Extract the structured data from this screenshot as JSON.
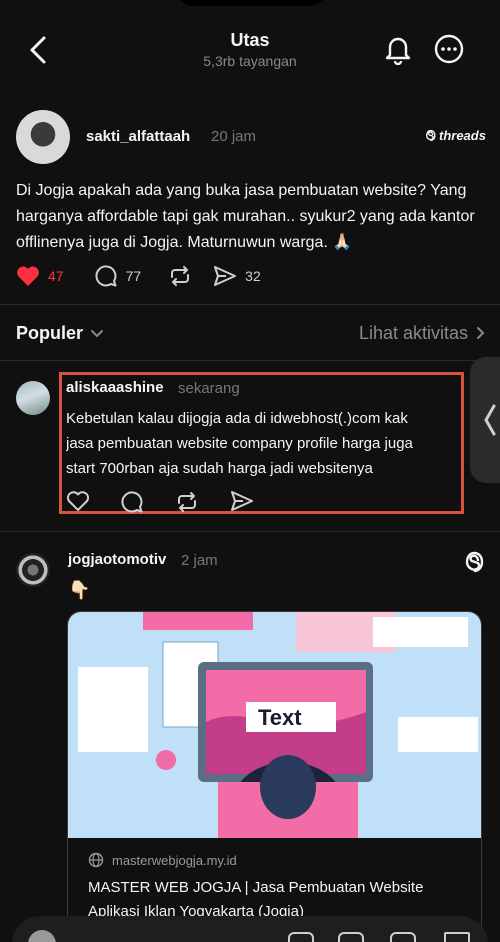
{
  "header": {
    "title": "Utas",
    "views": "5,3rb tayangan"
  },
  "post": {
    "username": "sakti_alfattaah",
    "time": "20 jam",
    "brand": "threads",
    "text": "Di Jogja apakah ada yang buka jasa pembuatan website? Yang harganya affordable tapi gak murahan.. syukur2 yang ada kantor offlinenya juga di Jogja. Maturnuwun warga. 🙏🏻",
    "likes": "47",
    "comments": "77",
    "shares": "32"
  },
  "sort": {
    "label": "Populer",
    "activity": "Lihat aktivitas"
  },
  "reply1": {
    "username": "aliskaaashine",
    "time": "sekarang",
    "lines": [
      "Kebetulan kalau dijogja ada di idwebhost(.)com kak",
      "jasa pembuatan website company profile harga juga",
      "start 700rban aja sudah harga jadi websitenya"
    ]
  },
  "reply2": {
    "username": "jogjaotomotiv",
    "time": "2 jam",
    "emoji": "👇🏻",
    "card": {
      "image_text": "Text",
      "domain": "masterwebjogja.my.id",
      "title": "MASTER WEB JOGJA | Jasa Pembuatan Website Aplikasi Iklan Yogyakarta (Jogja)"
    }
  },
  "colors": {
    "accent_like": "#ff3040",
    "highlight_border": "#d9513f",
    "background": "#101010"
  },
  "icons": [
    "back-arrow-icon",
    "bell-icon",
    "more-icon",
    "heart-icon",
    "comment-icon",
    "repost-icon",
    "share-icon",
    "chevron-down-icon",
    "chevron-right-icon",
    "threads-icon",
    "globe-icon"
  ]
}
